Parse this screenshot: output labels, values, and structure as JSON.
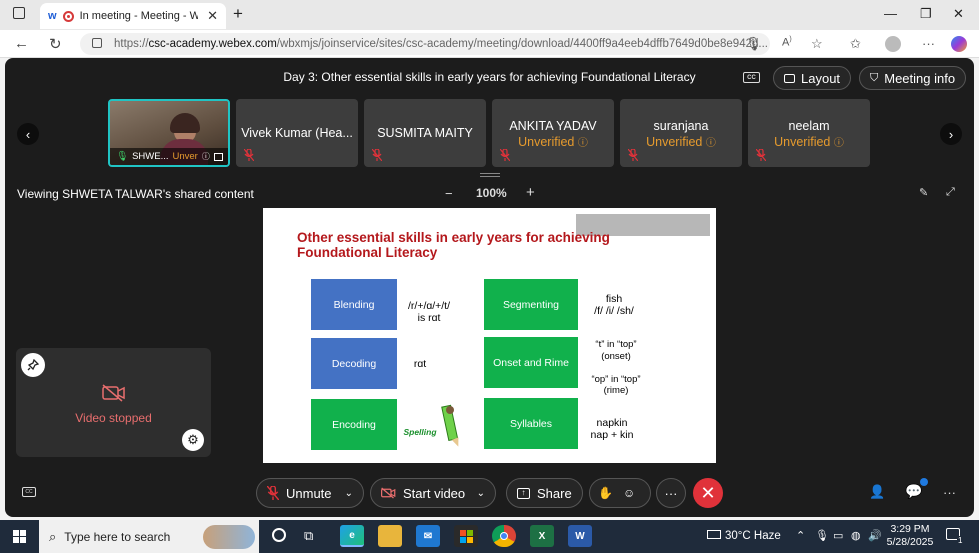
{
  "browser": {
    "tab_title": "In meeting - Meeting - Webex",
    "url_prefix": "https://",
    "url_host": "csc-academy.webex.com",
    "url_path": "/wbxmjs/joinservice/sites/csc-academy/meeting/download/4400ff9a4eeb4dffb7649d0be8e942d..."
  },
  "meeting": {
    "title": "Day 3: Other essential skills in early years for achieving Foundational Literacy",
    "layout_label": "Layout",
    "meeting_info_label": "Meeting info",
    "cc_label": "CC"
  },
  "participants": [
    {
      "name": "SHWE...",
      "status": "Unver"
    },
    {
      "name": "Vivek Kumar (Hea...",
      "status": ""
    },
    {
      "name": "SUSMITA MAITY",
      "status": ""
    },
    {
      "name": "ANKITA YADAV",
      "status": "Unverified"
    },
    {
      "name": "suranjana",
      "status": "Unverified"
    },
    {
      "name": "neelam",
      "status": "Unverified"
    }
  ],
  "share": {
    "viewing_text": "Viewing SHWETA TALWAR's shared content",
    "zoom": "100%",
    "zoom_minus": "−",
    "zoom_plus": "+"
  },
  "slide": {
    "title": "Other essential skills in early years for achieving Foundational Literacy",
    "left_boxes": [
      {
        "label": "Blending",
        "example": "/r/+/ɑ/+/t/\nis rɑt"
      },
      {
        "label": "Decoding",
        "example": "rɑt"
      },
      {
        "label": "Encoding",
        "example": "Spelling"
      }
    ],
    "right_boxes": [
      {
        "label": "Segmenting",
        "example": "fish\n/f/ /i/ /sh/"
      },
      {
        "label": "Onset and Rime",
        "example": "“t” in “top”\n(onset)\n\n“op” in “top”\n(rime)"
      },
      {
        "label": "Syllables",
        "example": "napkin\nnap + kin"
      }
    ]
  },
  "self_view": {
    "status": "Video stopped"
  },
  "controls": {
    "unmute": "Unmute",
    "start_video": "Start video",
    "share": "Share"
  },
  "taskbar": {
    "search_placeholder": "Type here to search",
    "weather": "30°C  Haze",
    "time": "3:29 PM",
    "date": "5/28/2025",
    "notif_count": "1"
  },
  "colors": {
    "meeting_bg": "#1c1c1c",
    "tile_bg": "#3d3d3d",
    "unverified": "#e69b2e",
    "muted_red": "#e0323a",
    "slide_title_red": "#b4181c",
    "slide_blue": "#4472c4",
    "slide_green": "#11b14c"
  }
}
